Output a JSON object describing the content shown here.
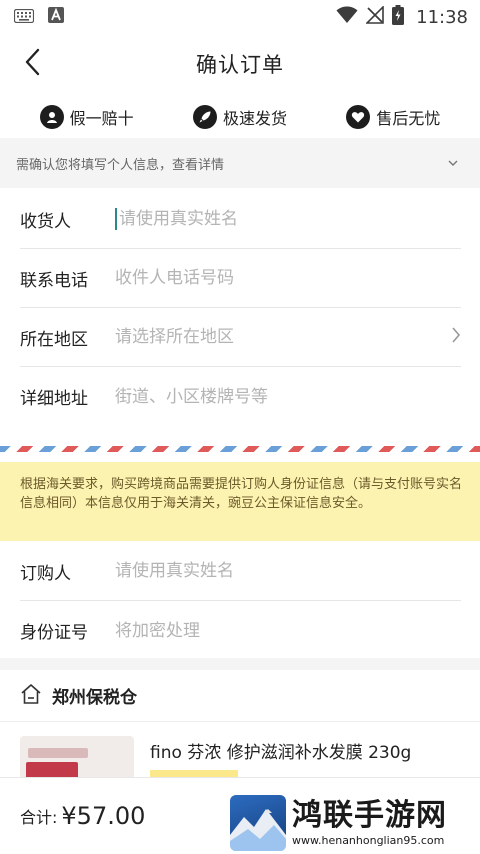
{
  "status_bar": {
    "time": "11:38",
    "icons": [
      "keyboard-icon",
      "a-app-icon",
      "wifi-icon",
      "no-signal-icon",
      "battery-charging-icon"
    ]
  },
  "nav": {
    "title": "确认订单",
    "back_icon": "chevron-left-icon"
  },
  "guarantees": [
    {
      "label": "假一赔十",
      "icon": "badge-icon"
    },
    {
      "label": "极速发货",
      "icon": "rocket-icon"
    },
    {
      "label": "售后无忧",
      "icon": "heart-icon"
    }
  ],
  "info_bar": {
    "text": "需确认您将填写个人信息，查看详情",
    "icon": "chevron-down-icon"
  },
  "address_form": {
    "recipient": {
      "label": "收货人",
      "placeholder": "请使用真实姓名"
    },
    "phone": {
      "label": "联系电话",
      "placeholder": "收件人电话号码"
    },
    "region": {
      "label": "所在地区",
      "placeholder": "请选择所在地区"
    },
    "detail": {
      "label": "详细地址",
      "placeholder": "街道、小区楼牌号等"
    }
  },
  "customs_notice": "根据海关要求，购买跨境商品需要提供订购人身份证信息（请与支付账号实名信息相同）本信息仅用于海关清关，豌豆公主保证信息安全。",
  "buyer_form": {
    "name": {
      "label": "订购人",
      "placeholder": "请使用真实姓名"
    },
    "id_number": {
      "label": "身份证号",
      "placeholder": "将加密处理"
    }
  },
  "warehouse": {
    "name": "郑州保税仓",
    "icon": "home-icon"
  },
  "product": {
    "name": "fino 芬浓 修护滋润补水发膜 230g"
  },
  "total": {
    "label": "合计:",
    "amount": "¥57.00"
  },
  "watermark": {
    "title": "鸿联手游网",
    "url": "www.henanhonglian95.com"
  },
  "colors": {
    "notice_bg": "#fdf3b0",
    "notice_text": "#6b5a2a",
    "airmail_red": "#e05a5a",
    "airmail_blue": "#6a9fd8",
    "caret": "#2a8a86"
  }
}
